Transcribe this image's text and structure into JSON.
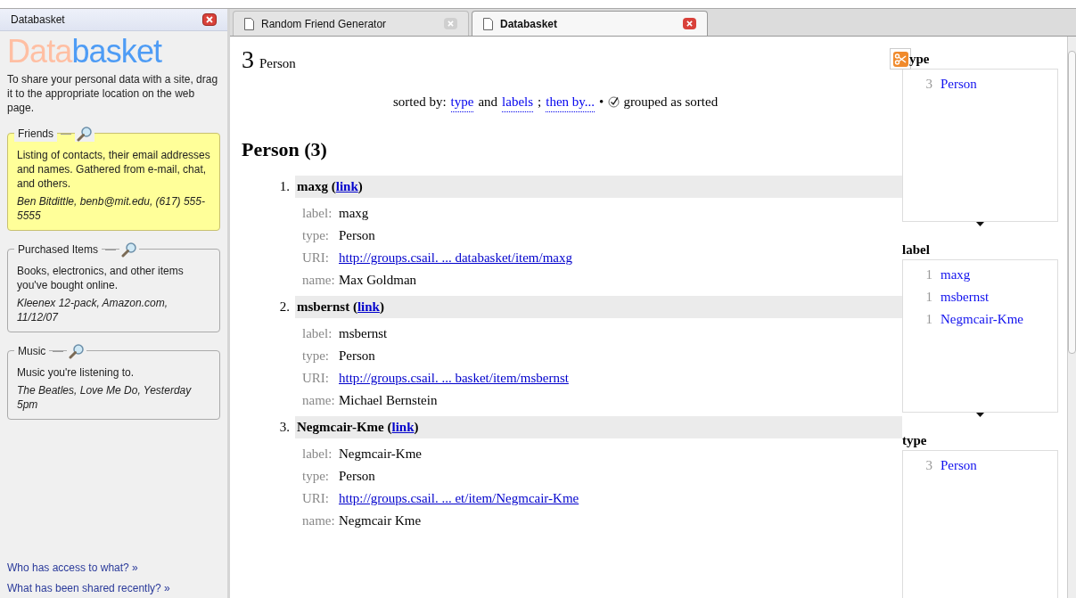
{
  "sidebar": {
    "title": "Databasket",
    "logo": {
      "first": "Data",
      "second": "basket"
    },
    "intro": "To share your personal data with a site, drag it to the appropriate location on the web page.",
    "sections": [
      {
        "title": "Friends",
        "selected": true,
        "description": "Listing of contacts, their email addresses and names. Gathered from e-mail, chat, and others.",
        "example": "Ben Bitdittle, benb@mit.edu, (617) 555-5555"
      },
      {
        "title": "Purchased Items",
        "selected": false,
        "description": "Books, electronics, and other items you've bought online.",
        "example": "Kleenex 12-pack, Amazon.com, 11/12/07"
      },
      {
        "title": "Music",
        "selected": false,
        "description": "Music you're listening to.",
        "example": "The Beatles, Love Me Do, Yesterday 5pm"
      }
    ],
    "links": [
      "Who has access to what? »",
      "What has been shared recently? »"
    ]
  },
  "tabs": [
    {
      "label": "Random Friend Generator",
      "selected": false
    },
    {
      "label": "Databasket",
      "selected": true
    }
  ],
  "summary": {
    "count": "3",
    "type": "Person"
  },
  "sort_line": [
    {
      "kind": "text",
      "text": "sorted by:"
    },
    {
      "kind": "link",
      "text": "type"
    },
    {
      "kind": "text",
      "text": "and"
    },
    {
      "kind": "link",
      "text": "labels"
    },
    {
      "kind": "text",
      "text": ";"
    },
    {
      "kind": "link",
      "text": "then by..."
    },
    {
      "kind": "text",
      "text": "•"
    },
    {
      "kind": "check",
      "text": "grouped as sorted",
      "checked": true
    }
  ],
  "group_heading": "Person (3)",
  "items": [
    {
      "number": "1.",
      "title": "maxg (",
      "link": "link",
      "after": ")",
      "properties": [
        {
          "key": "label:",
          "value": "maxg",
          "kind": "text"
        },
        {
          "key": "type:",
          "value": "Person",
          "kind": "text"
        },
        {
          "key": "URI:",
          "value": "http://groups.csail. ... databasket/item/maxg",
          "kind": "link"
        },
        {
          "key": "name:",
          "value": "Max Goldman",
          "kind": "text"
        }
      ]
    },
    {
      "number": "2.",
      "title": "msbernst (",
      "link": "link",
      "after": ")",
      "properties": [
        {
          "key": "label:",
          "value": "msbernst",
          "kind": "text"
        },
        {
          "key": "type:",
          "value": "Person",
          "kind": "text"
        },
        {
          "key": "URI:",
          "value": "http://groups.csail. ... basket/item/msbernst",
          "kind": "link"
        },
        {
          "key": "name:",
          "value": "Michael Bernstein",
          "kind": "text"
        }
      ]
    },
    {
      "number": "3.",
      "title": "Negmcair-Kme (",
      "link": "link",
      "after": ")",
      "properties": [
        {
          "key": "label:",
          "value": "Negmcair-Kme",
          "kind": "text"
        },
        {
          "key": "type:",
          "value": "Person",
          "kind": "text"
        },
        {
          "key": "URI:",
          "value": "http://groups.csail. ... et/item/Negmcair-Kme",
          "kind": "link"
        },
        {
          "key": "name:",
          "value": "Negmcair Kme",
          "kind": "text"
        }
      ]
    }
  ],
  "facets": [
    {
      "title": "ype",
      "values": [
        {
          "count": "3",
          "label": "Person"
        }
      ]
    },
    {
      "title": "label",
      "values": [
        {
          "count": "1",
          "label": "maxg"
        },
        {
          "count": "1",
          "label": "msbernst"
        },
        {
          "count": "1",
          "label": "Negmcair-Kme"
        }
      ]
    },
    {
      "title": "type",
      "values": [
        {
          "count": "3",
          "label": "Person"
        }
      ]
    }
  ]
}
